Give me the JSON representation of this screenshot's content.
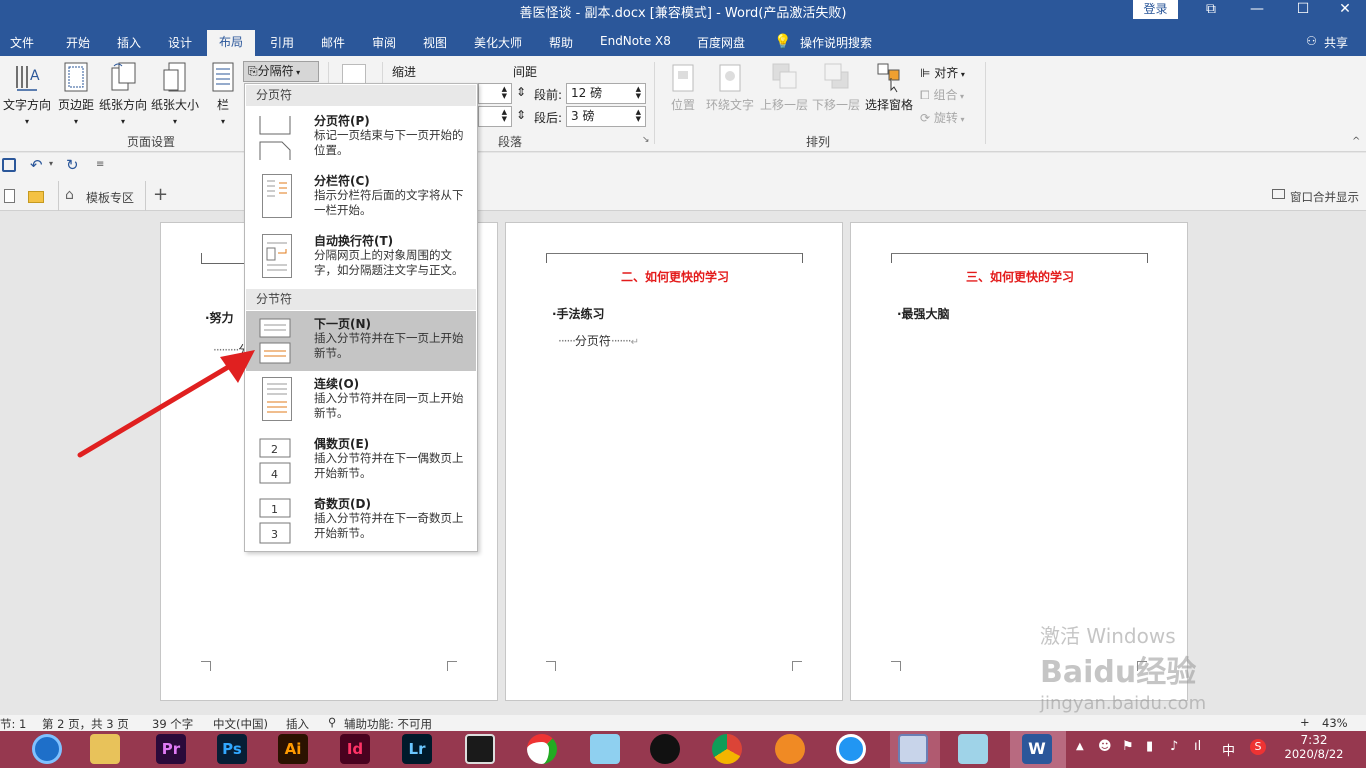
{
  "titlebar": {
    "title": "善医怪谈 - 副本.docx [兼容模式]  -  Word(产品激活失败)",
    "login": "登录",
    "controls": [
      "⧉",
      "—",
      "☐",
      "✕"
    ]
  },
  "tabs": [
    "文件",
    "开始",
    "插入",
    "设计",
    "布局",
    "引用",
    "邮件",
    "审阅",
    "视图",
    "美化大师",
    "帮助",
    "EndNote X8",
    "百度网盘"
  ],
  "tell_me": "操作说明搜索",
  "share": "共享",
  "ribbon": {
    "page_setup": {
      "buttons": [
        "文字方向",
        "页边距",
        "纸张方向",
        "纸张大小",
        "栏"
      ],
      "breaks_button": "分隔符",
      "group_label": "页面设置"
    },
    "paragraph": {
      "indent_label": "缩进",
      "spacing_label": "间距",
      "before_label": "段前:",
      "before_value": "12 磅",
      "after_label": "段后:",
      "after_value": "3 磅",
      "group_label": "段落"
    },
    "arrange": {
      "buttons": [
        "位置",
        "环绕文字",
        "上移一层",
        "下移一层",
        "选择窗格"
      ],
      "align": "对齐",
      "group": "组合",
      "rotate": "旋转",
      "group_label": "排列"
    }
  },
  "doctabs": {
    "template_tab": "模板专区",
    "add": "+",
    "merge": "窗口合并显示"
  },
  "pages": {
    "p1": {
      "heading": "·努力",
      "break": "分"
    },
    "p2": {
      "heading": "二、如何更快的学习",
      "body": "·手法练习",
      "break": "分页符"
    },
    "p3": {
      "heading": "三、如何更快的学习",
      "body": "·最强大脑"
    }
  },
  "dropdown": {
    "section1": "分页符",
    "section2": "分节符",
    "items": [
      {
        "title": "分页符(P)",
        "desc": "标记一页结束与下一页开始的位置。"
      },
      {
        "title": "分栏符(C)",
        "desc": "指示分栏符后面的文字将从下一栏开始。"
      },
      {
        "title": "自动换行符(T)",
        "desc": "分隔网页上的对象周围的文字，如分隔题注文字与正文。"
      },
      {
        "title": "下一页(N)",
        "desc": "插入分节符并在下一页上开始新节。"
      },
      {
        "title": "连续(O)",
        "desc": "插入分节符并在同一页上开始新节。"
      },
      {
        "title": "偶数页(E)",
        "desc": "插入分节符并在下一偶数页上开始新节。"
      },
      {
        "title": "奇数页(D)",
        "desc": "插入分节符并在下一奇数页上开始新节。"
      }
    ]
  },
  "statusbar": {
    "section": "节: 1",
    "page": "第 2 页，共 3 页",
    "words": "39 个字",
    "language": "中文(中国)",
    "insert": "插入",
    "accessibility": "辅助功能: 不可用",
    "zoom": "43%"
  },
  "taskbar": {
    "ime": "中",
    "time": "7:32",
    "date": "2020/8/22"
  },
  "watermark": {
    "line1": "激活 Windows",
    "line2": "Baidu经验",
    "line3": "jingyan.baidu.com"
  }
}
